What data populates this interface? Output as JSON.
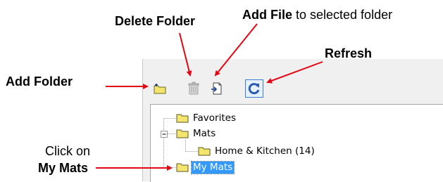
{
  "annotations": {
    "delete_folder": "Delete Folder",
    "add_file_bold": "Add File",
    "add_file_rest": " to selected folder",
    "refresh": "Refresh",
    "add_folder": "Add Folder",
    "click_on": "Click on",
    "my_mats": "My Mats"
  },
  "toolbar": {
    "buttons": [
      {
        "name": "add-folder",
        "icon": "folder-add-icon",
        "enabled": true
      },
      {
        "name": "delete-folder",
        "icon": "trash-icon",
        "enabled": false
      },
      {
        "name": "add-file",
        "icon": "file-add-icon",
        "enabled": true
      },
      {
        "name": "refresh",
        "icon": "refresh-icon",
        "enabled": true
      }
    ]
  },
  "tree": {
    "items": [
      {
        "label": "Favorites",
        "expander": "none",
        "selected": false
      },
      {
        "label": "Mats",
        "expander": "minus",
        "selected": false
      },
      {
        "label": "Home & Kitchen (14)",
        "expander": "none",
        "selected": false
      },
      {
        "label": "My Mats",
        "expander": "none",
        "selected": true
      }
    ]
  },
  "colors": {
    "arrow": "#e30613",
    "folder": "#f4e56e",
    "selection": "#3399ff",
    "refresh_icon": "#2a5db0"
  }
}
